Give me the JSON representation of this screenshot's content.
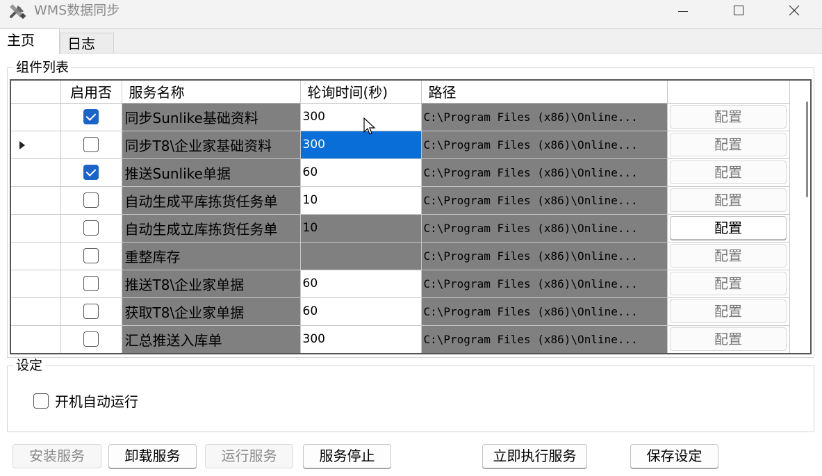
{
  "window": {
    "title": "WMS数据同步",
    "icons": {
      "app": "tools-icon",
      "min": "minimize-icon",
      "max": "maximize-icon",
      "close": "close-icon"
    }
  },
  "tabs": [
    {
      "label": "主页",
      "active": true
    },
    {
      "label": "日志",
      "active": false
    }
  ],
  "components": {
    "group_title": "组件列表",
    "columns": [
      "启用否",
      "服务名称",
      "轮询时间(秒)",
      "路径",
      ""
    ],
    "rows": [
      {
        "enabled": true,
        "name": "同步Sunlike基础资料",
        "interval": "300",
        "path": "C:\\Program Files (x86)\\Online...",
        "button": "配置",
        "interval_style": "white"
      },
      {
        "enabled": false,
        "name": "同步T8\\企业家基础资料",
        "interval": "300",
        "path": "C:\\Program Files (x86)\\Online...",
        "button": "配置",
        "interval_style": "selected",
        "current": true
      },
      {
        "enabled": true,
        "name": "推送Sunlike单据",
        "interval": "60",
        "path": "C:\\Program Files (x86)\\Online...",
        "button": "配置",
        "interval_style": "white"
      },
      {
        "enabled": false,
        "name": "自动生成平库拣货任务单",
        "interval": "10",
        "path": "C:\\Program Files (x86)\\Online...",
        "button": "配置",
        "interval_style": "white"
      },
      {
        "enabled": false,
        "name": "自动生成立库拣货任务单",
        "interval": "10",
        "path": "C:\\Program Files (x86)\\Online...",
        "button": "配置",
        "interval_style": "gray",
        "button_focus": true
      },
      {
        "enabled": false,
        "name": "重整库存",
        "interval": "",
        "path": "C:\\Program Files (x86)\\Online...",
        "button": "配置",
        "interval_style": "gray"
      },
      {
        "enabled": false,
        "name": "推送T8\\企业家单据",
        "interval": "60",
        "path": "C:\\Program Files (x86)\\Online...",
        "button": "配置",
        "interval_style": "white"
      },
      {
        "enabled": false,
        "name": "获取T8\\企业家单据",
        "interval": "60",
        "path": "C:\\Program Files (x86)\\Online...",
        "button": "配置",
        "interval_style": "white"
      },
      {
        "enabled": false,
        "name": "汇总推送入库单",
        "interval": "300",
        "path": "C:\\Program Files (x86)\\Online...",
        "button": "配置",
        "interval_style": "white"
      }
    ]
  },
  "settings": {
    "group_title": "设定",
    "auto_run_label": "开机自动运行",
    "auto_run_checked": false
  },
  "buttons": [
    {
      "label": "安装服务",
      "enabled": false
    },
    {
      "label": "卸载服务",
      "enabled": true
    },
    {
      "label": "运行服务",
      "enabled": false
    },
    {
      "label": "服务停止",
      "enabled": true
    },
    {
      "label": "立即执行服务",
      "enabled": true
    },
    {
      "label": "保存设定",
      "enabled": true
    }
  ],
  "colors": {
    "selected_cell": "#0a6ed8",
    "readonly_cell": "#808080",
    "checkbox_on": "#1a63c9"
  }
}
